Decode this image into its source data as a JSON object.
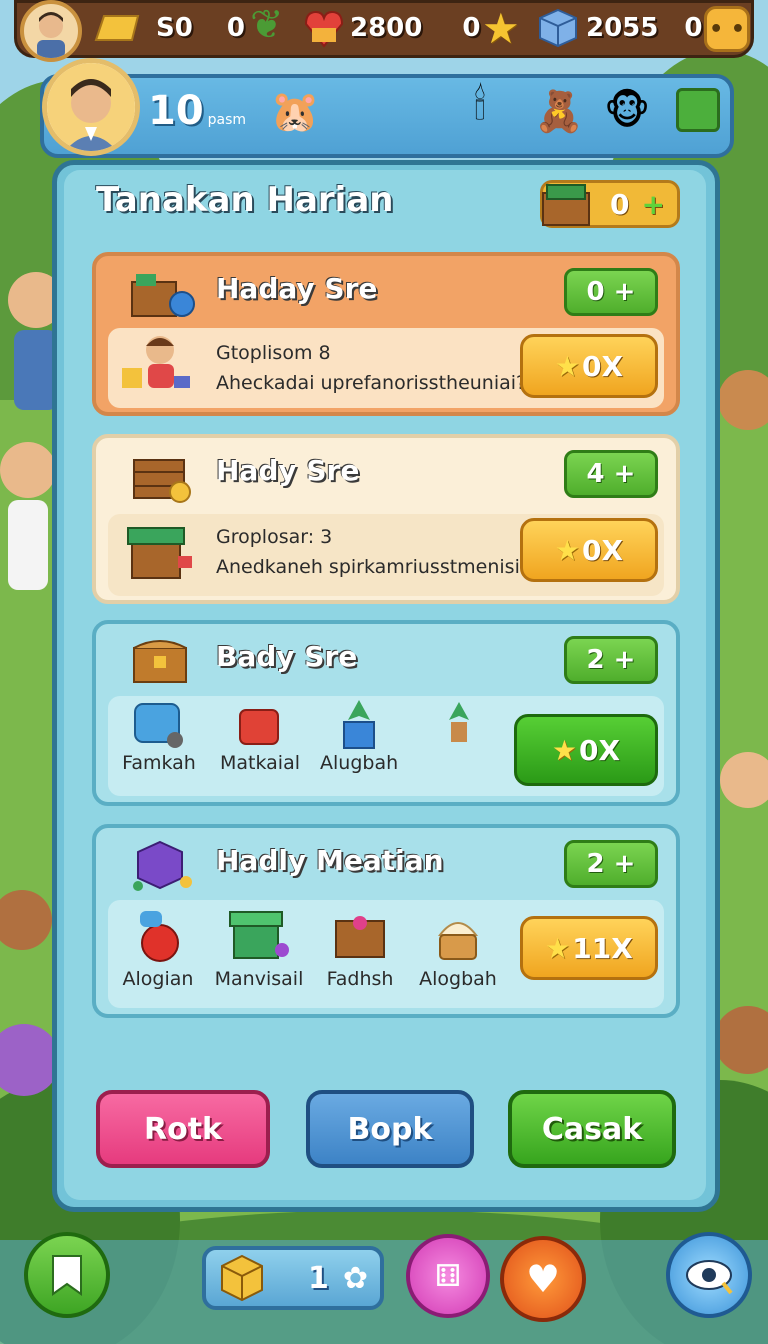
{
  "topbar": {
    "gold": "S0",
    "gold_extra": "0",
    "hearts": "2800",
    "hearts_extra": "0",
    "cubes": "2055",
    "cubes_extra": "0"
  },
  "header": {
    "level": "10",
    "level_unit": "pasm"
  },
  "panel": {
    "title": "Tanakan Harian",
    "counter": "0",
    "counter_plus": "+"
  },
  "cards": [
    {
      "title": "Haday Sre",
      "badge": "0 +",
      "line1": "Gtoplisom 8",
      "line2": "Aheckadai uprefanorisstheuniai?",
      "action": "0X"
    },
    {
      "title": "Hady Sre",
      "badge": "4 +",
      "line1": "Groplosar: 3",
      "line2": "Anedkaneh spirkamriusstmenisi?",
      "action": "0X"
    },
    {
      "title": "Bady Sre",
      "badge": "2 +",
      "items": [
        "Famkah",
        "Matkaial",
        "Alugbah",
        ""
      ],
      "action": "0X"
    },
    {
      "title": "Hadly Meatian",
      "badge": "2 +",
      "items": [
        "Alogian",
        "Manvisail",
        "Fadhsh",
        "Alogbah"
      ],
      "action": "11X"
    }
  ],
  "footer": {
    "btn1": "Rotk",
    "btn2": "Bopk",
    "btn3": "Casak"
  },
  "bottom": {
    "inventory_count": "1"
  },
  "colors": {
    "orange_card": "#f2a366",
    "cream_card": "#fbefd8",
    "teal_card": "#a8e0ea",
    "green_button": "#3fb52a",
    "pink_button": "#ef4f8d",
    "blue_button": "#4d95d2"
  }
}
